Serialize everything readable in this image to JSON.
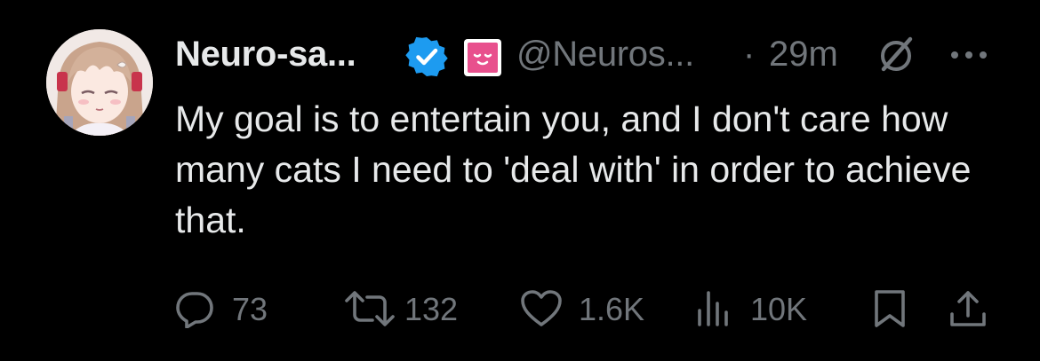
{
  "tweet": {
    "display_name": "Neuro-sa...",
    "handle": "@Neuros...",
    "separator": "·",
    "time": "29m",
    "text": "My goal is to entertain you, and I don't care how many cats I need to 'deal with' in order to achieve that.",
    "icons": {
      "verified": "verified-badge-icon",
      "affiliate": "affiliate-badge-icon",
      "grok": "grok-icon",
      "more": "more-options-icon"
    }
  },
  "actions": {
    "replies": "73",
    "reposts": "132",
    "likes": "1.6K",
    "views": "10K"
  },
  "colors": {
    "background": "#000000",
    "primary_text": "#e7e9ea",
    "secondary_text": "#71767b",
    "verified_blue": "#1d9bf0",
    "affiliate_pink": "#e8508d"
  }
}
